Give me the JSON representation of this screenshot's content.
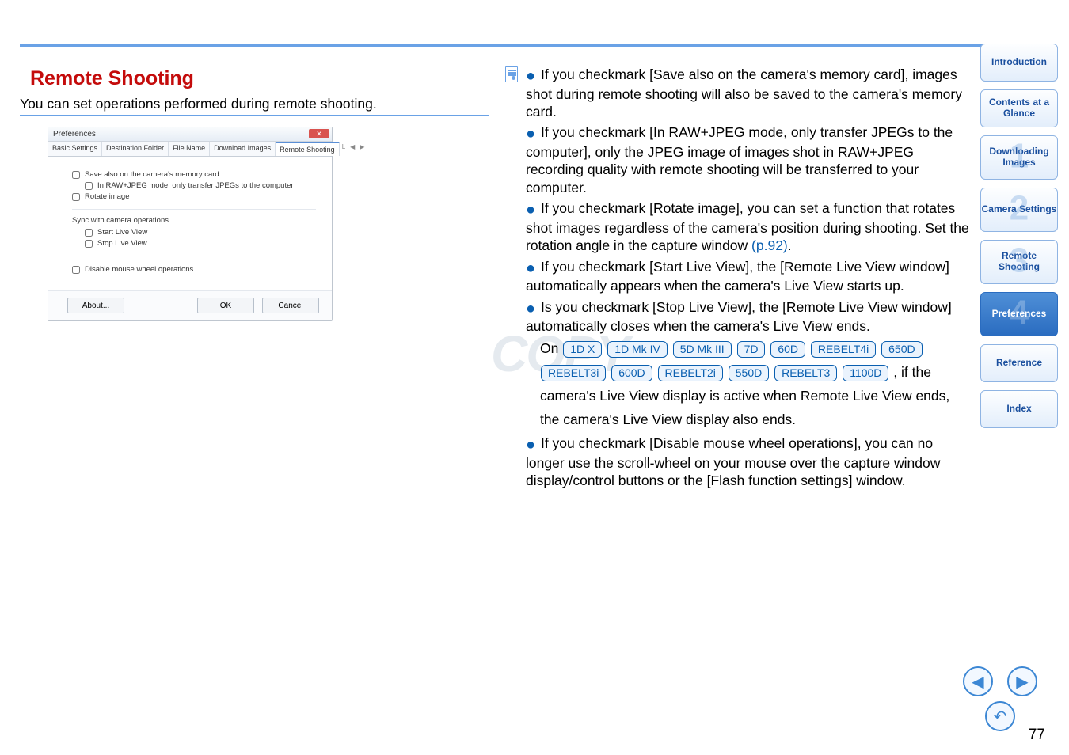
{
  "page": {
    "heading": "Remote Shooting",
    "intro": "You can set operations performed during remote shooting.",
    "pageNumber": "77"
  },
  "dialog": {
    "title": "Preferences",
    "tabs": {
      "basic": "Basic Settings",
      "dest": "Destination Folder",
      "file": "File Name",
      "download": "Download Images",
      "remote": "Remote Shooting",
      "scrollL": "L",
      "scrollLeft": "◀",
      "scrollRight": "▶"
    },
    "chk": {
      "saveAlso": "Save also on the camera's memory card",
      "inRawJpeg": "In RAW+JPEG mode, only transfer JPEGs to the computer",
      "rotate": "Rotate image",
      "syncLabel": "Sync with camera operations",
      "startLV": "Start Live View",
      "stopLV": "Stop Live View",
      "disableWheel": "Disable mouse wheel operations"
    },
    "buttons": {
      "about": "About...",
      "ok": "OK",
      "cancel": "Cancel"
    }
  },
  "bullets": {
    "b1": "If you checkmark [Save also on the camera's memory card], images shot during remote shooting will also be saved to the camera's memory card.",
    "b2": "If you checkmark [In RAW+JPEG mode, only transfer JPEGs to the computer], only the JPEG image of images shot in RAW+JPEG recording quality with remote shooting will be transferred to your computer.",
    "b3a": "If you checkmark [Rotate image], you can set a function that rotates shot images regardless of the camera's position during shooting. Set the rotation angle in the capture window ",
    "b3link": "(p.92)",
    "b3b": ".",
    "b4": "If you checkmark [Start Live View], the [Remote Live View window] automatically appears when the camera's Live View starts up.",
    "b5": "Is you checkmark [Stop Live View], the [Remote Live View window] automatically closes when the camera's Live View ends.",
    "onLabel": "On",
    "badges": [
      "1D X",
      "1D Mk IV",
      "5D Mk III",
      "7D",
      "60D",
      "REBELT4i",
      "650D",
      "REBELT3i",
      "600D",
      "REBELT2i",
      "550D",
      "REBELT3",
      "1100D"
    ],
    "afterBadges": ", if the camera's Live View display is active when Remote Live View ends, the camera's Live View display also ends.",
    "b6": "If you checkmark [Disable mouse wheel operations], you can no longer use the scroll-wheel on your mouse over the capture window display/control buttons or the [Flash function settings] window."
  },
  "nav": {
    "intro": "Introduction",
    "contents": "Contents at a Glance",
    "down": "Downloading Images",
    "cam": "Camera Settings",
    "remote": "Remote Shooting",
    "pref": "Preferences",
    "ref": "Reference",
    "index": "Index",
    "n1": "1",
    "n2": "2",
    "n3": "3",
    "n4": "4"
  },
  "wm": "COPY"
}
